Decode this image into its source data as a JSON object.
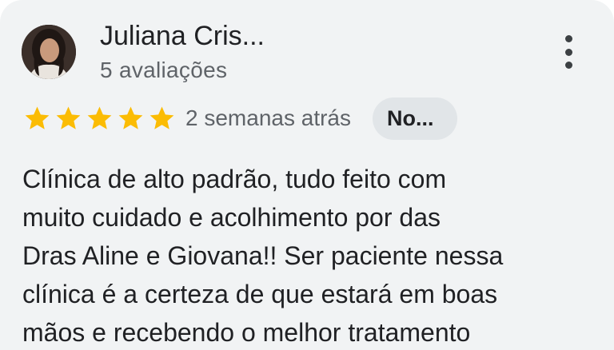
{
  "review": {
    "author_name": "Juliana Cris...",
    "author_reviews_count": "5 avaliações",
    "rating": 5,
    "rating_max": 5,
    "date": "2 semanas atrás",
    "chip_label": "No...",
    "text_lines": [
      "Clínica de alto padrão, tudo feito com",
      "muito cuidado e acolhimento por das",
      "Dras Aline e Giovana!! Ser paciente nessa",
      "clínica é a certeza de que estará em boas",
      "mãos e recebendo o melhor tratamento"
    ]
  },
  "colors": {
    "card_background": "#f1f3f4",
    "star": "#fbbc04",
    "primary_text": "#202124",
    "secondary_text": "#5f6368",
    "chip_background": "#e1e5e8"
  },
  "icons": {
    "more": "more-vert-icon",
    "star": "star-icon"
  }
}
